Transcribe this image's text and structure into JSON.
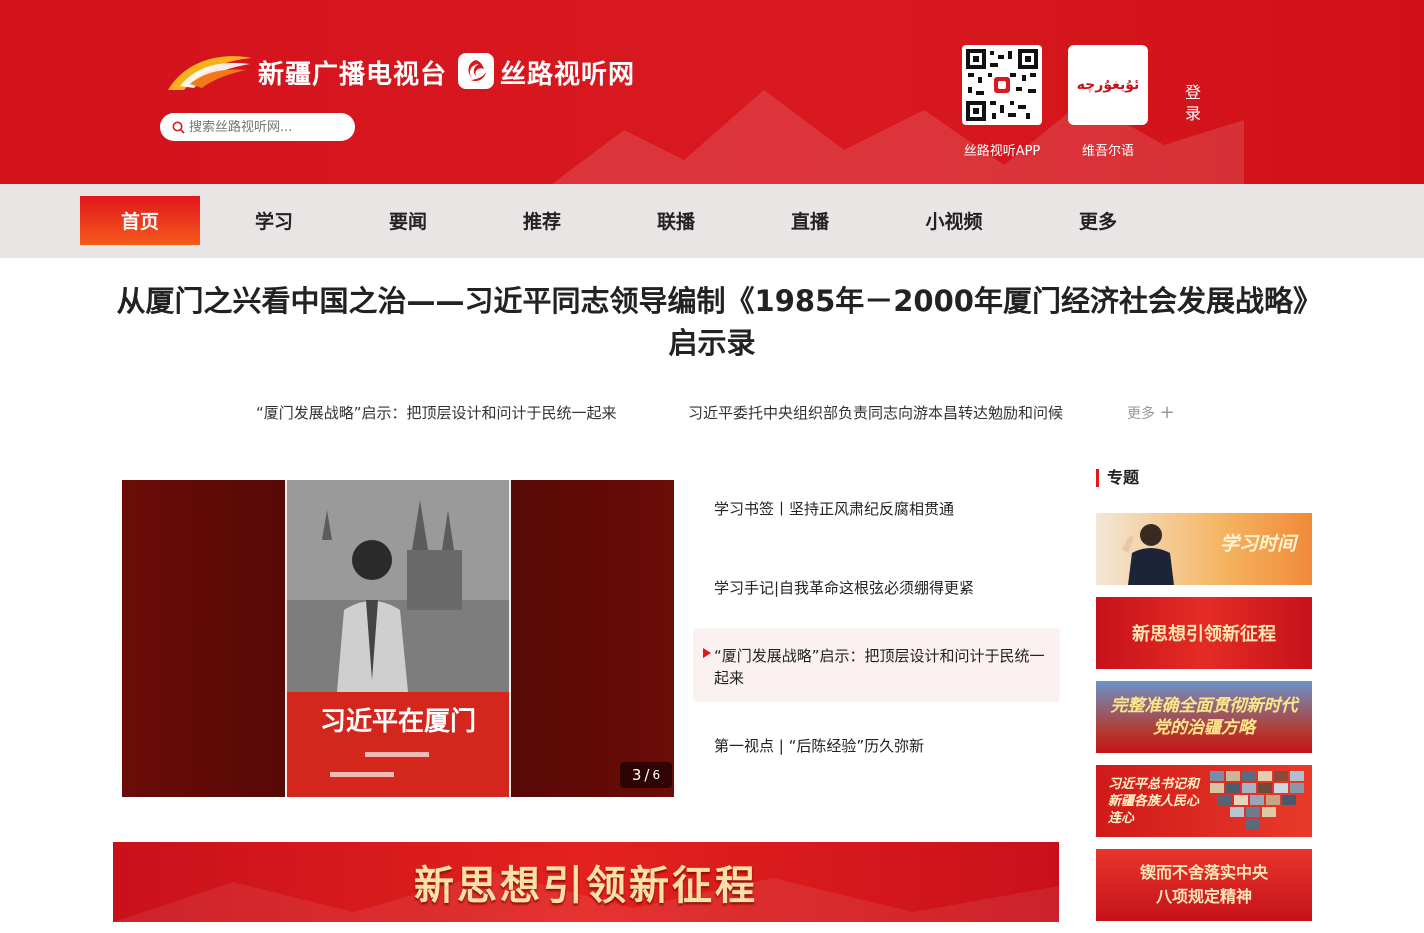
{
  "header": {
    "brand_name": "新疆广播电视台",
    "site_name": "丝路视听网",
    "search_placeholder": "搜索丝路视听网...",
    "qr_label": "丝路视听APP",
    "uyghur_text": "ئۇيغۇرچە",
    "uyghur_label": "维吾尔语",
    "login_label": "登录"
  },
  "nav": {
    "items": [
      {
        "label": "首页",
        "active": true
      },
      {
        "label": "学习"
      },
      {
        "label": "要闻"
      },
      {
        "label": "推荐"
      },
      {
        "label": "联播"
      },
      {
        "label": "直播"
      },
      {
        "label": "小视频"
      },
      {
        "label": "更多"
      }
    ]
  },
  "article": {
    "headline": "从厦门之兴看中国之治——习近平同志领导编制《1985年－2000年厦门经济社会发展战略》启示录",
    "sublinks": [
      "“厦门发展战略”启示：把顶层设计和问计于民统一起来",
      "习近平委托中央组织部负责同志向游本昌转达勉励和问候"
    ],
    "more_label": "更多"
  },
  "carousel": {
    "book_title": "习近平在厦门",
    "current": "3",
    "total": "6"
  },
  "news_list": [
    "学习书签丨坚持正风肃纪反腐相贯通",
    "学习手记|自我革命这根弦必须绷得更紧",
    "“厦门发展战略”启示：把顶层设计和问计于民统一起来",
    "第一视点 | “后陈经验”历久弥新"
  ],
  "sidebar": {
    "title": "专题",
    "topics": [
      "学习时间",
      "新思想引领新征程",
      "完整准确全面贯彻新时代党的治疆方略",
      "习近平总书记和新疆各族人民心连心",
      "锲而不舍落实中央八项规定精神"
    ]
  },
  "banner": {
    "label": "新思想引领新征程"
  },
  "colors": {
    "brand_red": "#d91920",
    "nav_bg": "#e9e5e5",
    "active_gradient_end": "#f45a1a"
  }
}
